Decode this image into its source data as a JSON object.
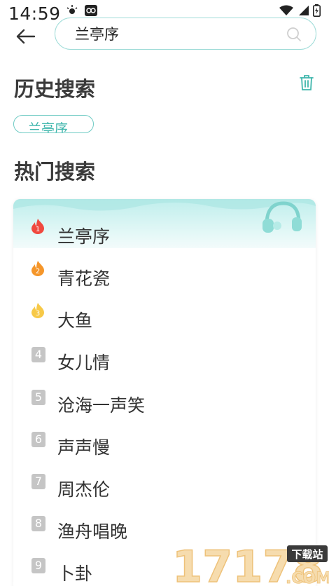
{
  "status_bar": {
    "time": "14:59"
  },
  "search": {
    "value": "兰亭序"
  },
  "history": {
    "title": "历史搜索",
    "items": [
      "兰亭序"
    ]
  },
  "hot": {
    "title": "热门搜索",
    "items": [
      {
        "rank": "1",
        "label": "兰亭序",
        "style": "fire-red"
      },
      {
        "rank": "2",
        "label": "青花瓷",
        "style": "fire-orange"
      },
      {
        "rank": "3",
        "label": "大鱼",
        "style": "fire-yellow"
      },
      {
        "rank": "4",
        "label": "女儿情",
        "style": "gray"
      },
      {
        "rank": "5",
        "label": "沧海一声笑",
        "style": "gray"
      },
      {
        "rank": "6",
        "label": "声声慢",
        "style": "gray"
      },
      {
        "rank": "7",
        "label": "周杰伦",
        "style": "gray"
      },
      {
        "rank": "8",
        "label": "渔舟唱晚",
        "style": "gray"
      },
      {
        "rank": "9",
        "label": "卜卦",
        "style": "gray"
      }
    ]
  },
  "watermark": {
    "number": "17178",
    "tag": "下载站",
    "domain": ".COM"
  },
  "colors": {
    "accent": "#3fb6ac",
    "search_border": "#9fdcd8",
    "rank_gray": "#c5c5c5",
    "fire_red": "#f0483e",
    "fire_orange": "#f5962a",
    "fire_yellow": "#f7c948"
  },
  "icons": {
    "back": "arrow-left-icon",
    "search": "search-icon",
    "trash": "trash-icon",
    "headphones": "headphones-icon"
  }
}
